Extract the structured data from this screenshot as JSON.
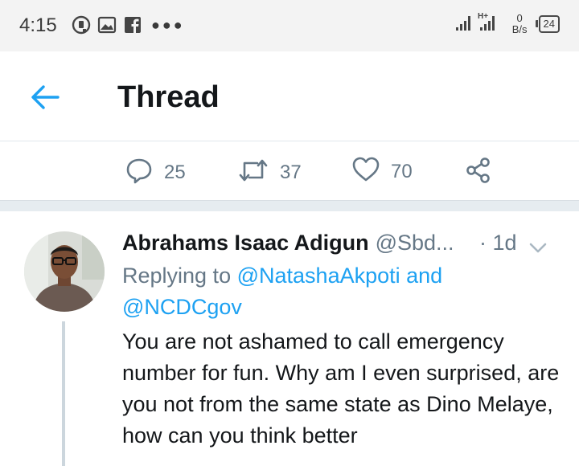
{
  "status_bar": {
    "time": "4:15",
    "network_speed_value": "0",
    "network_speed_unit": "B/s",
    "signal_label": "H+",
    "battery": "24"
  },
  "header": {
    "title": "Thread"
  },
  "actions": {
    "replies": "25",
    "retweets": "37",
    "likes": "70"
  },
  "reply": {
    "author_name": "Abrahams Isaac Adigun",
    "author_handle": "@Sbd...",
    "time": "· 1d",
    "replying_prefix": "Replying to",
    "mention_1": "@NatashaAkpoti",
    "conjunction": "and",
    "mention_2": "@NCDCgov",
    "text": "You are not ashamed to call emergency number for fun. Why am I even surprised, are you not from the same state as Dino Melaye, how can you think better"
  },
  "colors": {
    "accent": "#1da1f2",
    "secondary_text": "#657786",
    "primary_text": "#14171a"
  }
}
